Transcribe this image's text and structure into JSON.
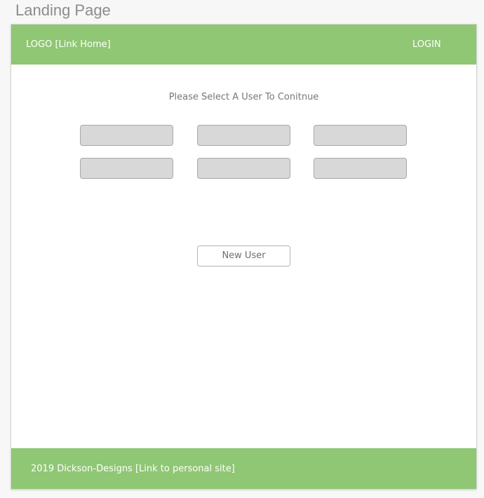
{
  "page": {
    "title": "Landing Page"
  },
  "header": {
    "logo_label": "LOGO [Link Home]",
    "login_label": "LOGIN"
  },
  "main": {
    "prompt": "Please Select A User To Conitnue",
    "user_buttons": [
      {
        "label": ""
      },
      {
        "label": ""
      },
      {
        "label": ""
      },
      {
        "label": ""
      },
      {
        "label": ""
      },
      {
        "label": ""
      }
    ],
    "new_user_label": "New User"
  },
  "footer": {
    "text": "2019 Dickson-Designs [Link to personal site]"
  },
  "colors": {
    "accent_green": "#8fc774",
    "button_gray": "#d8d8d8",
    "text_gray": "#777777",
    "background": "#f7f7f7"
  }
}
